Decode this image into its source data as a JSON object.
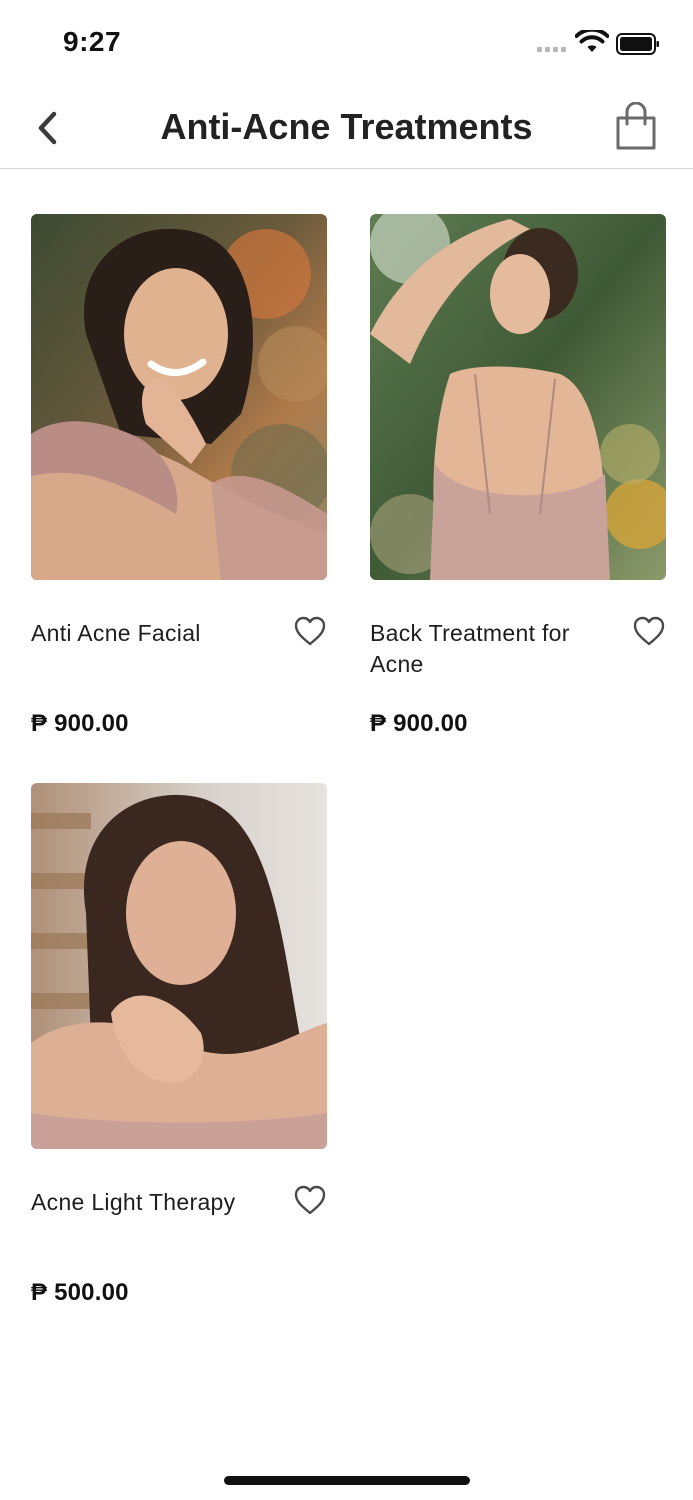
{
  "status_bar": {
    "time": "9:27"
  },
  "header": {
    "title": "Anti-Acne Treatments"
  },
  "products": [
    {
      "name": "Anti Acne Facial",
      "price": "₱ 900.00",
      "photo": "woman-smiling-ruffled-dress-photo"
    },
    {
      "name": "Back Treatment for Acne",
      "price": "₱ 900.00",
      "photo": "woman-bare-back-outdoors-photo"
    },
    {
      "name": "Acne Light Therapy",
      "price": "₱ 500.00",
      "photo": "woman-hand-on-cheek-photo"
    }
  ],
  "icons": {
    "back": "chevron-left-icon",
    "cart": "shopping-bag-icon",
    "favorite": "heart-outline-icon"
  },
  "colors": {
    "text": "#1a1a1a",
    "divider": "#d9d9d9",
    "background": "#ffffff"
  }
}
